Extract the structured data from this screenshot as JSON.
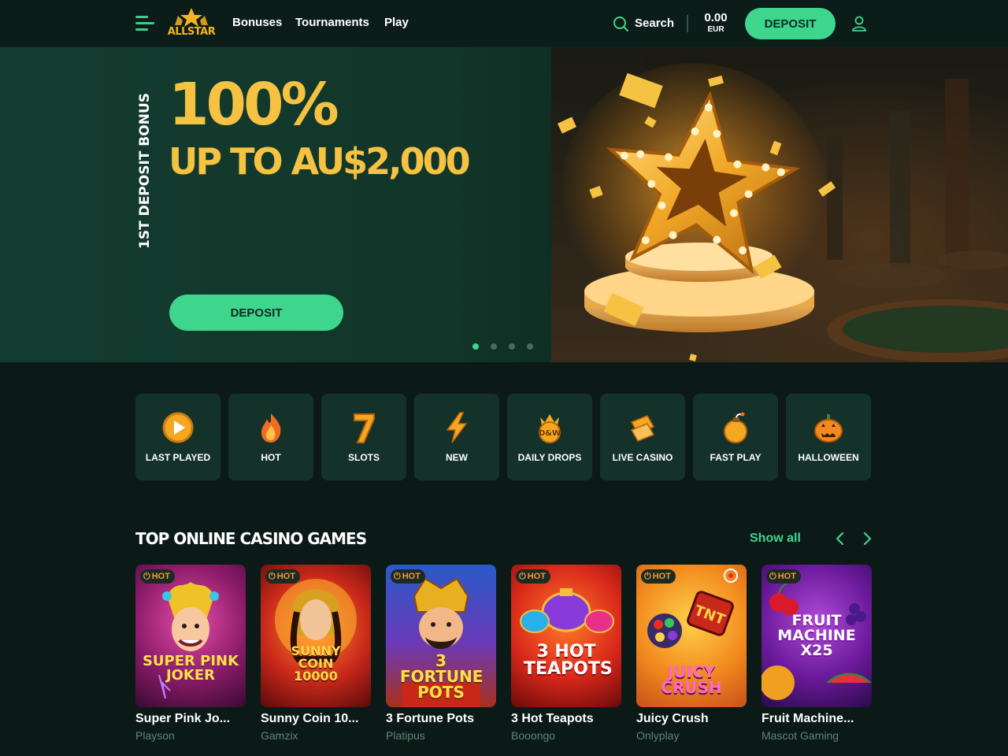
{
  "header": {
    "logo_text": "ALLSTAR",
    "nav": [
      "Bonuses",
      "Tournaments",
      "Play"
    ],
    "search_label": "Search",
    "balance_amount": "0.00",
    "balance_currency": "EUR",
    "deposit_label": "DEPOSIT"
  },
  "hero": {
    "vertical_text": "1ST DEPOSIT BONUS",
    "headline": "100%",
    "subline": "UP TO AU$2,000",
    "deposit_label": "DEPOSIT",
    "slides": 4,
    "active_slide": 1
  },
  "categories": [
    {
      "label": "LAST PLAYED",
      "icon": "play-circle-icon"
    },
    {
      "label": "HOT",
      "icon": "flame-icon"
    },
    {
      "label": "SLOTS",
      "icon": "seven-icon"
    },
    {
      "label": "NEW",
      "icon": "lightning-icon"
    },
    {
      "label": "DAILY DROPS",
      "icon": "daily-drops-icon"
    },
    {
      "label": "LIVE CASINO",
      "icon": "cards-icon"
    },
    {
      "label": "FAST PLAY",
      "icon": "bomb-icon"
    },
    {
      "label": "HALLOWEEN",
      "icon": "pumpkin-icon"
    }
  ],
  "top_games": {
    "title": "TOP ONLINE CASINO GAMES",
    "show_all": "Show all",
    "games": [
      {
        "name": "Super Pink Jo...",
        "provider": "Playson",
        "badge": "HOT",
        "art": "SUPER PINK JOKER"
      },
      {
        "name": "Sunny Coin 10...",
        "provider": "Gamzix",
        "badge": "HOT",
        "art": "SUNNY COIN 10000"
      },
      {
        "name": "3 Fortune Pots",
        "provider": "Platipus",
        "badge": "HOT",
        "art": "3 FORTUNE POTS"
      },
      {
        "name": "3 Hot Teapots",
        "provider": "Booongo",
        "badge": "HOT",
        "art": "3 HOT TEAPOTS"
      },
      {
        "name": "Juicy Crush",
        "provider": "Onlyplay",
        "badge": "HOT",
        "art": "JUICY CRUSH"
      },
      {
        "name": "Fruit Machine...",
        "provider": "Mascot Gaming",
        "badge": "HOT",
        "art": "FRUIT MACHINE X25"
      }
    ]
  },
  "colors": {
    "accent": "#3ed58d",
    "gold": "#f5c242",
    "background": "#0b1a17",
    "tile": "#15322a"
  }
}
